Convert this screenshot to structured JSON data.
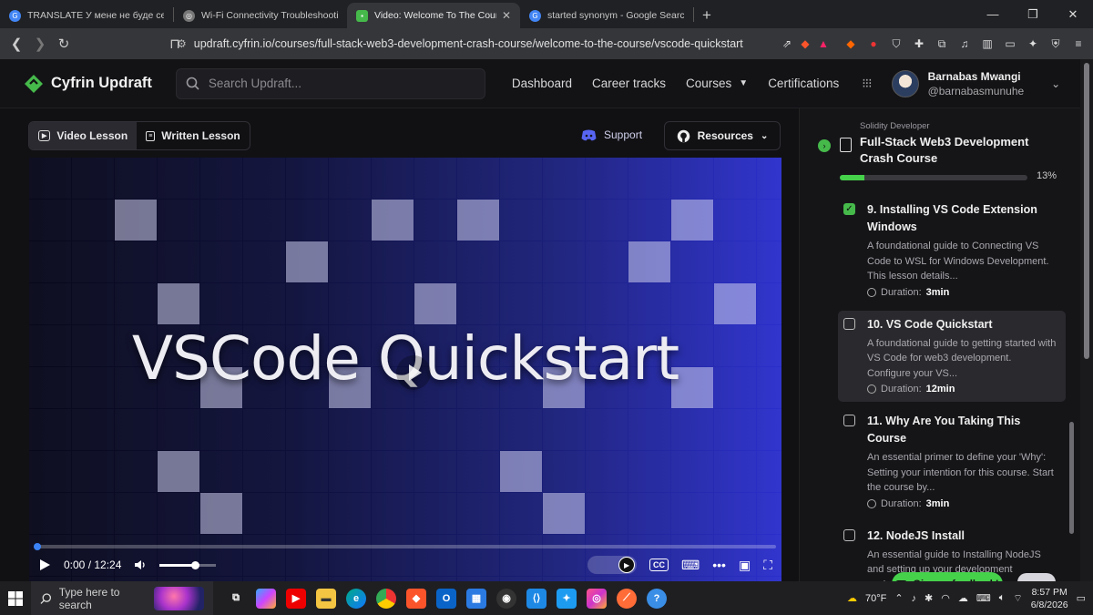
{
  "browser": {
    "tabs": [
      {
        "title": "TRANSLATE У мене не буде сексу !!",
        "active": false,
        "fav_color": "#4285f4"
      },
      {
        "title": "Wi-Fi Connectivity Troubleshooting",
        "active": false,
        "fav_color": "#777777"
      },
      {
        "title": "Video: Welcome To The Course -",
        "active": true,
        "fav_color": "#46b94b"
      },
      {
        "title": "started synonym - Google Search",
        "active": false,
        "fav_color": "#4285f4"
      }
    ],
    "url": "updraft.cyfrin.io/courses/full-stack-web3-development-crash-course/welcome-to-the-course/vscode-quickstart"
  },
  "site": {
    "brand": "Cyfrin Updraft",
    "brand_color": "#46b94b",
    "search_placeholder": "Search Updraft...",
    "nav": {
      "dashboard": "Dashboard",
      "career_tracks": "Career tracks",
      "courses": "Courses",
      "certifications": "Certifications"
    },
    "user": {
      "name": "Barnabas Mwangi",
      "handle": "@barnabasmunuhe"
    }
  },
  "lesson_view": {
    "video_lesson_label": "Video Lesson",
    "written_lesson_label": "Written Lesson",
    "support_label": "Support",
    "resources_label": "Resources",
    "video": {
      "title_overlay": "VSCode Quickstart",
      "time": "0:00 / 12:24",
      "progress": 0.0,
      "volume": 0.62,
      "cc_label": "CC"
    }
  },
  "sidebar": {
    "path": "Solidity Developer",
    "course_title": "Full-Stack Web3 Development Crash Course",
    "progress_pct": 13,
    "progress_label": "13%",
    "lessons": [
      {
        "title": "9. Installing VS Code Extension Windows",
        "desc": "A foundational guide to Connecting VS Code to WSL for Windows Development. This lesson details...",
        "duration_label": "Duration:",
        "duration": "3min",
        "done": true,
        "current": false
      },
      {
        "title": "10. VS Code Quickstart",
        "desc": "A foundational guide to getting started with VS Code for web3 development. Configure your VS...",
        "duration_label": "Duration:",
        "duration": "12min",
        "done": false,
        "current": true
      },
      {
        "title": "11. Why Are You Taking This Course",
        "desc": "An essential primer to define your 'Why': Setting your intention for this course. Start the course by...",
        "duration_label": "Duration:",
        "duration": "3min",
        "done": false,
        "current": false
      },
      {
        "title": "12. NodeJS Install",
        "desc": "An essential guide to Installing NodeJS and setting up your development environment. Learn",
        "duration_label": "Du",
        "duration": "",
        "done": false,
        "current": false
      }
    ],
    "feedback_label": "Give us feedback!"
  },
  "taskbar": {
    "search_placeholder": "Type here to search",
    "weather": "70°F",
    "time": "8:57 PM",
    "date": "6/8/2026"
  }
}
